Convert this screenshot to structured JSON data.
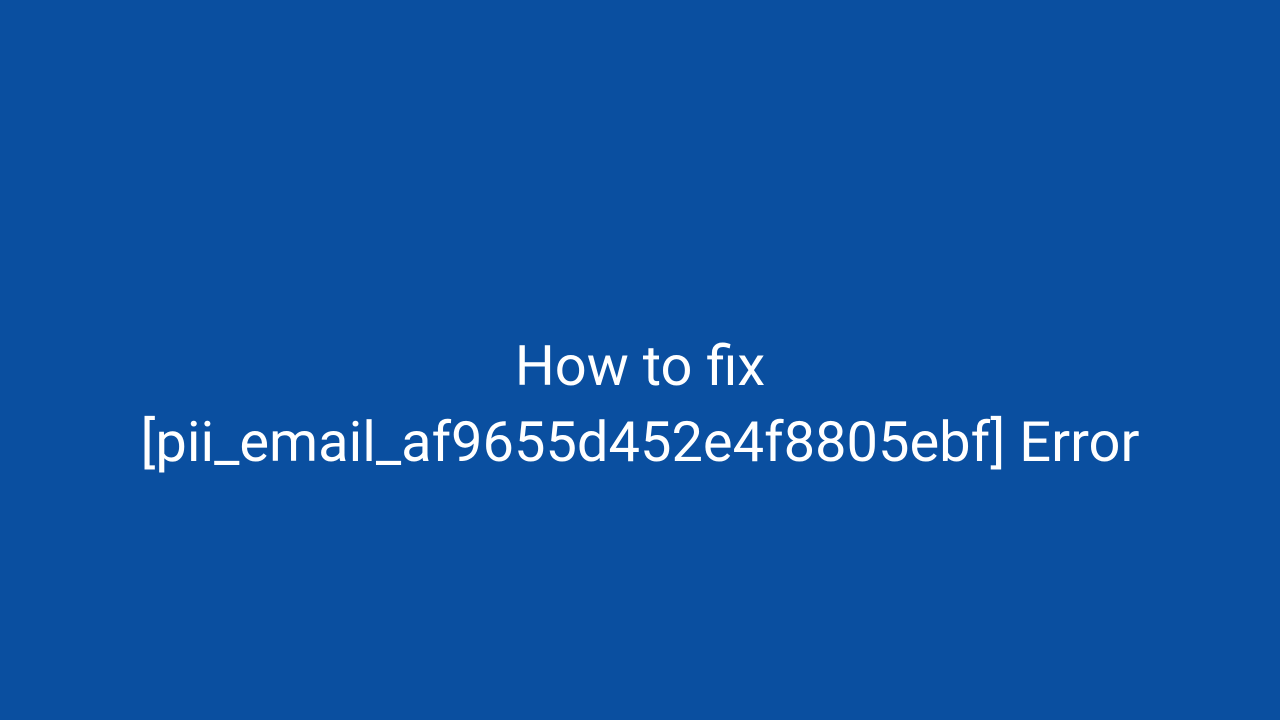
{
  "heading": {
    "line1": "How to  fix",
    "line2": "[pii_email_af9655d452e4f8805ebf] Error"
  },
  "colors": {
    "background": "#0a4fa0",
    "text": "#ffffff"
  }
}
